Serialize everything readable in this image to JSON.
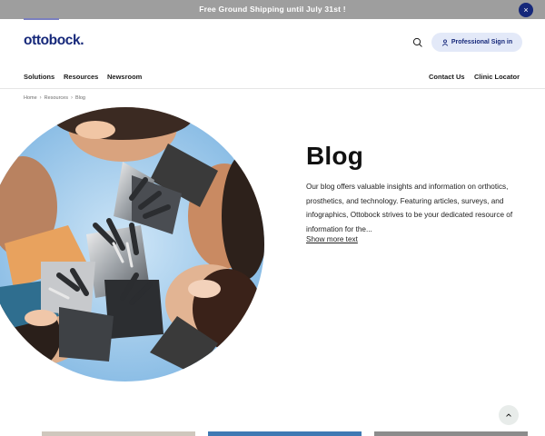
{
  "promo": {
    "text": "Free Ground Shipping until July 31st !",
    "close_label": "×"
  },
  "header": {
    "logo": "ottobock.",
    "pro_signin_label": "Professional Sign in"
  },
  "nav": {
    "solutions": "Solutions",
    "resources": "Resources",
    "newsroom": "Newsroom",
    "contact": "Contact Us",
    "clinic_locator": "Clinic Locator"
  },
  "breadcrumb": {
    "items": [
      "Home",
      "Resources",
      "Blog"
    ],
    "separator": "›"
  },
  "hero": {
    "title": "Blog",
    "description": "Our blog offers valuable insights and information on orthotics, prosthetics, and technology. Featuring articles, surveys, and infographics, Ottobock strives to be your dedicated resource of information for the...",
    "show_more": "Show more text"
  },
  "icons": {
    "search": "search-icon",
    "user": "user-icon",
    "close": "close-icon",
    "scroll_up": "chevron-up-icon"
  },
  "colors": {
    "brand": "#16287a",
    "promo_bg": "#9e9e9e",
    "pro_btn_bg": "#e3e9f8"
  }
}
